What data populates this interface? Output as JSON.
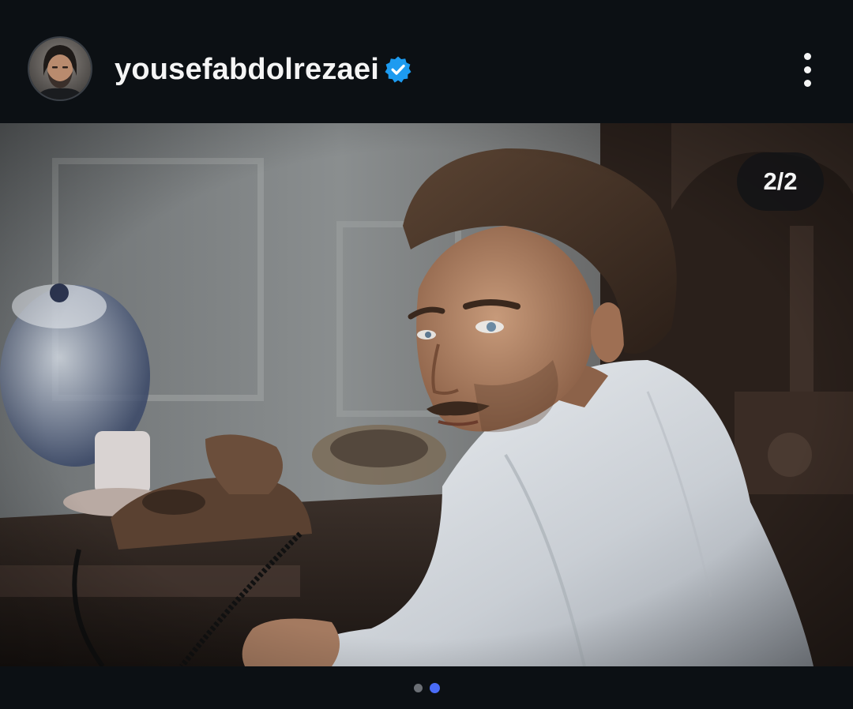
{
  "post": {
    "author": {
      "username": "yousefabdolrezaei",
      "verified": true,
      "avatar_icon": "profile-photo"
    },
    "media": {
      "carousel_counter": "2/2",
      "current_index": 2,
      "total": 2,
      "photo_description_icon": "man-in-white-shirt-at-desk-photo"
    },
    "pager": {
      "dots": [
        "dot-1",
        "dot-2"
      ],
      "active_dot": 2
    }
  },
  "colors": {
    "background": "#0c1014",
    "text": "#f5f5f5",
    "verified_badge": "#1d9bf0",
    "active_dot": "#4a6cf7",
    "inactive_dot": "#6b6f75"
  }
}
